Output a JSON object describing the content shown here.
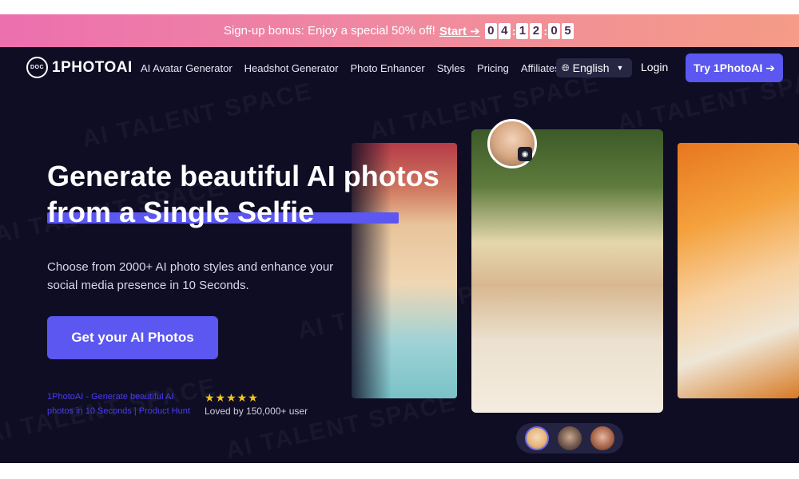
{
  "promo": {
    "text": "Sign-up bonus: Enjoy a special 50% off!",
    "start_label": "Start ➔",
    "countdown": [
      "0",
      "4",
      "1",
      "2",
      "0",
      "5"
    ]
  },
  "nav": {
    "logo_text": "1PHOTOAI",
    "logo_mark_text": "DOC",
    "links": [
      "AI Avatar Generator",
      "Headshot Generator",
      "Photo Enhancer",
      "Styles",
      "Pricing",
      "Affiliates"
    ],
    "language": "English",
    "login": "Login",
    "try_button": "Try 1PhotoAI ➔"
  },
  "hero": {
    "title_line1": "Generate beautiful AI photos",
    "title_line2": "from a Single Selfie",
    "subtitle": "Choose from 2000+ AI photo styles and enhance your social media presence in 10 Seconds.",
    "cta": "Get your AI Photos",
    "product_hunt_alt": "1PhotoAI - Generate beautiful AI photos in 10 Seconds | Product Hunt",
    "rating_stars": "★★★★★",
    "loved_text": "Loved by 150,000+ user"
  },
  "watermark": "AI TALENT SPACE",
  "icons": {
    "globe": "globe-icon",
    "chevron": "chevron-down-icon",
    "camera": "camera-icon"
  }
}
